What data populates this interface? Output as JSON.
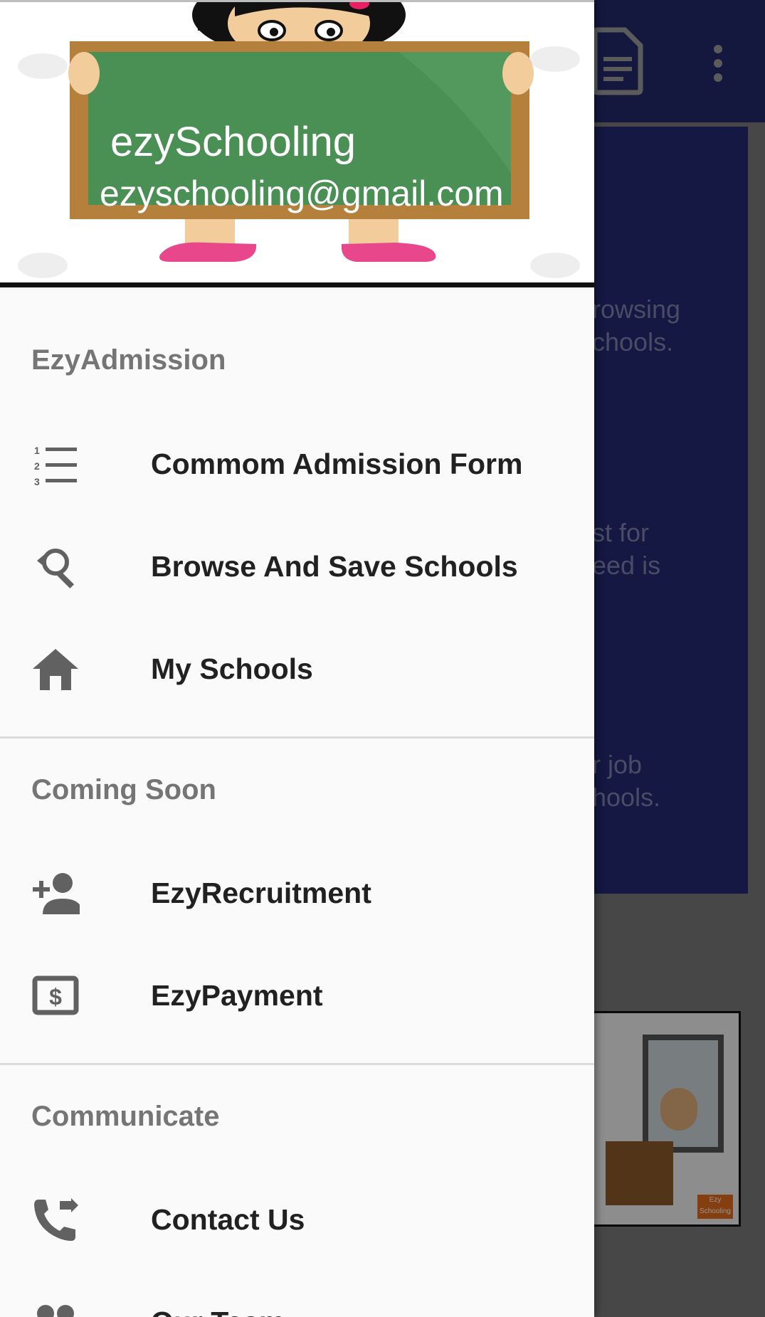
{
  "header": {
    "name": "ezySchooling",
    "email": "ezyschooling@gmail.com"
  },
  "background": {
    "texts": [
      "rowsing\nchools.",
      "st for\need is",
      "r job\nhools."
    ],
    "image_badge": "Ezy\nSchooling"
  },
  "sections": [
    {
      "title": "EzyAdmission",
      "items": [
        {
          "label": "Commom Admission Form",
          "icon": "numbered-list-icon"
        },
        {
          "label": "Browse And Save Schools",
          "icon": "search-refresh-icon"
        },
        {
          "label": "My Schools",
          "icon": "home-icon"
        }
      ]
    },
    {
      "title": "Coming Soon",
      "items": [
        {
          "label": "EzyRecruitment",
          "icon": "person-add-icon"
        },
        {
          "label": "EzyPayment",
          "icon": "money-bill-icon"
        }
      ]
    },
    {
      "title": "Communicate",
      "items": [
        {
          "label": "Contact Us",
          "icon": "phone-forward-icon"
        },
        {
          "label": "Our Team",
          "icon": "group-icon"
        }
      ]
    }
  ],
  "colors": {
    "toolbar": "#242a6b",
    "card": "#232a72",
    "drawer_bg": "#fafafa",
    "section_title": "#757575",
    "item_text": "#212121",
    "icon": "#616161"
  }
}
